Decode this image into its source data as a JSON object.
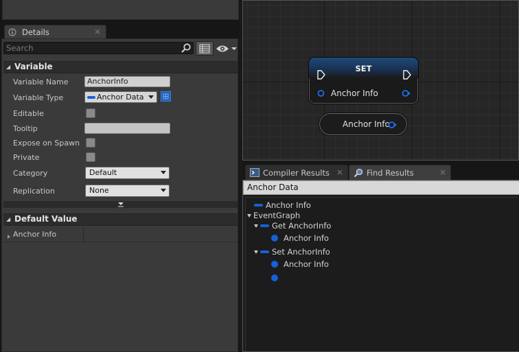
{
  "details": {
    "tab_label": "Details",
    "close_glyph": "×",
    "search_placeholder": "Search",
    "variable": {
      "header": "Variable",
      "rows": {
        "name_label": "Variable Name",
        "name_value": "AnchorInfo",
        "type_label": "Variable Type",
        "type_value": "Anchor Data",
        "editable_label": "Editable",
        "tooltip_label": "Tooltip",
        "tooltip_value": "",
        "expose_label": "Expose on Spawn",
        "private_label": "Private",
        "category_label": "Category",
        "category_value": "Default",
        "replication_label": "Replication",
        "replication_value": "None"
      }
    },
    "default_value": {
      "header": "Default Value",
      "item_label": "Anchor Info"
    }
  },
  "graph": {
    "set_node": {
      "title": "SET",
      "pin_label": "Anchor Info"
    },
    "get_node": {
      "pin_label": "Anchor Info"
    }
  },
  "results": {
    "tabs": [
      {
        "label": "Compiler Results",
        "icon": "compiler-log-icon"
      },
      {
        "label": "Find Results",
        "icon": "magnifier-icon"
      }
    ],
    "close_glyph": "×",
    "query": "Anchor Data",
    "tree": {
      "root_variable": "Anchor Info",
      "event_graph": "EventGraph",
      "get_node": "Get AnchorInfo",
      "get_pin": "Anchor Info",
      "set_node": "Set AnchorInfo",
      "set_pin": "Anchor Info"
    }
  },
  "colors": {
    "pin_blue": "#1860d8",
    "panel": "#3a3a3a",
    "background": "#161616"
  }
}
